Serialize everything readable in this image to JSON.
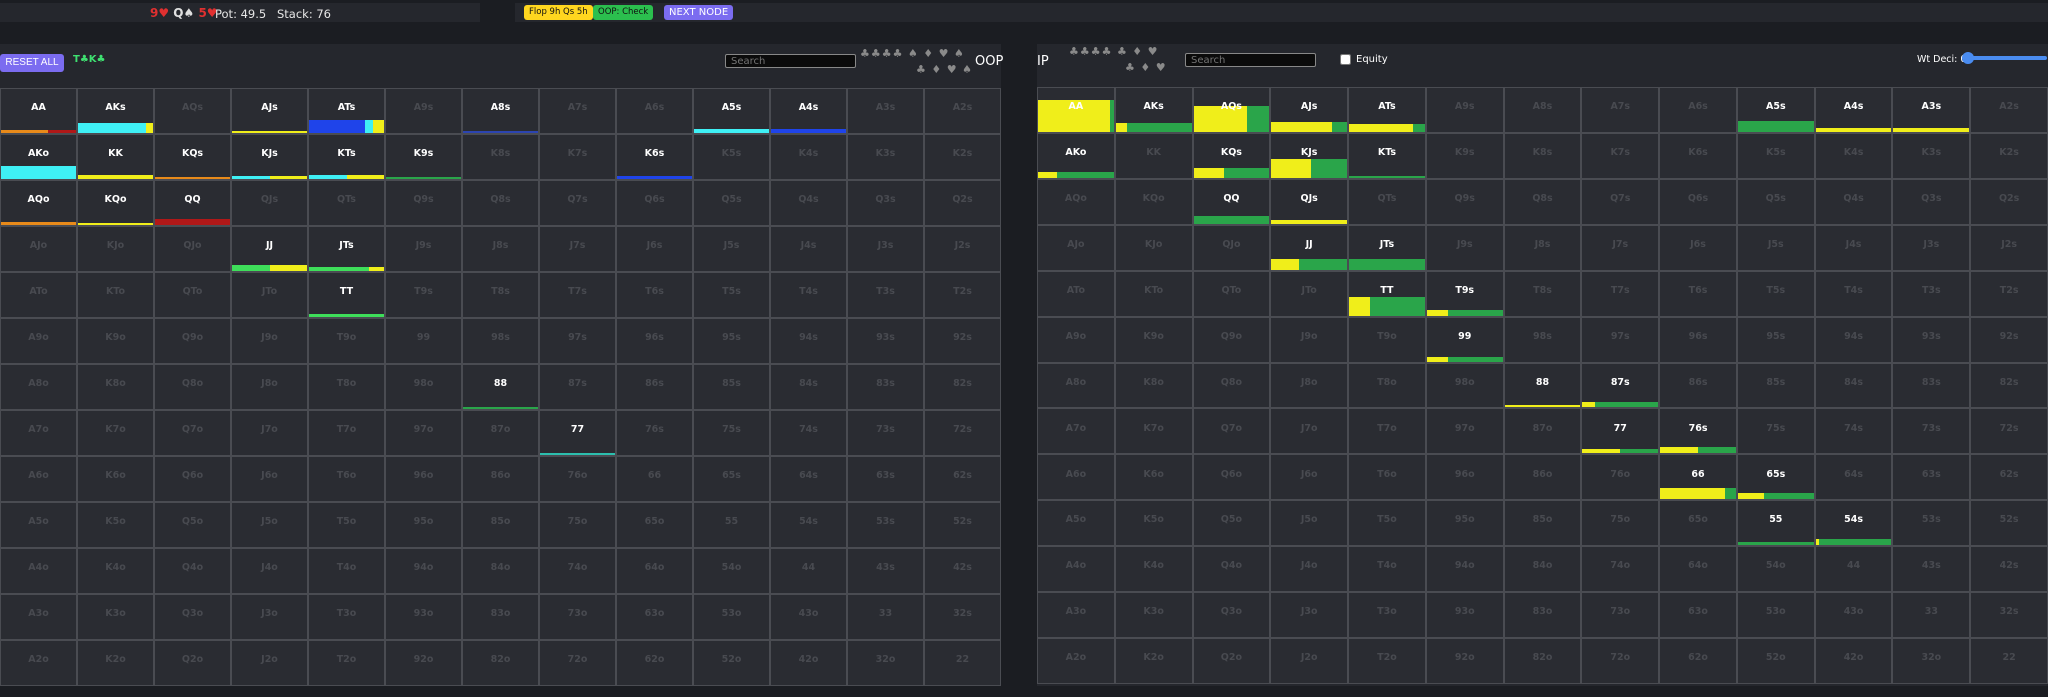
{
  "topbar": {
    "board": [
      {
        "text": "9♥",
        "color": "red"
      },
      {
        "text": "Q♠",
        "color": "black"
      },
      {
        "text": "5♥",
        "color": "red"
      }
    ],
    "pot": "Pot: 49.5",
    "stack": "Stack: 76",
    "pills": {
      "flop": "Flop 9h Qs 5h",
      "oop_action": "OOP: Check",
      "next_node": "NEXT NODE"
    }
  },
  "left_panel": {
    "reset_label": "RESET ALL",
    "turn_label": "T♣K♣",
    "search_placeholder": "Search",
    "suits_row1": "♣♣♣♣ ♠ ♦ ♥ ♠",
    "suits_row2": "♣ ♦ ♥ ♠",
    "position": "OOP"
  },
  "right_panel": {
    "position": "IP",
    "suits_row1": "♣♣♣♣ ♣ ♦ ♥",
    "suits_row2": "♣ ♦ ♥",
    "search_placeholder": "Search",
    "equity_label": "Equity",
    "wt_deci_label": "Wt Deci: 0"
  },
  "colors": {
    "cyan": "#3ff0f5",
    "yellow": "#f0ee1a",
    "green": "#2aa54a",
    "blue": "#1f44ea",
    "red": "#b01818",
    "orange": "#e88a1a",
    "teal": "#2cbfae",
    "lightgreen": "#3ede5a",
    "darkblue": "#2c44b0"
  },
  "hands": [
    [
      "AA",
      "AKs",
      "AQs",
      "AJs",
      "ATs",
      "A9s",
      "A8s",
      "A7s",
      "A6s",
      "A5s",
      "A4s",
      "A3s",
      "A2s"
    ],
    [
      "AKo",
      "KK",
      "KQs",
      "KJs",
      "KTs",
      "K9s",
      "K8s",
      "K7s",
      "K6s",
      "K5s",
      "K4s",
      "K3s",
      "K2s"
    ],
    [
      "AQo",
      "KQo",
      "QQ",
      "QJs",
      "QTs",
      "Q9s",
      "Q8s",
      "Q7s",
      "Q6s",
      "Q5s",
      "Q4s",
      "Q3s",
      "Q2s"
    ],
    [
      "AJo",
      "KJo",
      "QJo",
      "JJ",
      "JTs",
      "J9s",
      "J8s",
      "J7s",
      "J6s",
      "J5s",
      "J4s",
      "J3s",
      "J2s"
    ],
    [
      "ATo",
      "KTo",
      "QTo",
      "JTo",
      "TT",
      "T9s",
      "T8s",
      "T7s",
      "T6s",
      "T5s",
      "T4s",
      "T3s",
      "T2s"
    ],
    [
      "A9o",
      "K9o",
      "Q9o",
      "J9o",
      "T9o",
      "99",
      "98s",
      "97s",
      "96s",
      "95s",
      "94s",
      "93s",
      "92s"
    ],
    [
      "A8o",
      "K8o",
      "Q8o",
      "J8o",
      "T8o",
      "98o",
      "88",
      "87s",
      "86s",
      "85s",
      "84s",
      "83s",
      "82s"
    ],
    [
      "A7o",
      "K7o",
      "Q7o",
      "J7o",
      "T7o",
      "97o",
      "87o",
      "77",
      "76s",
      "75s",
      "74s",
      "73s",
      "72s"
    ],
    [
      "A6o",
      "K6o",
      "Q6o",
      "J6o",
      "T6o",
      "96o",
      "86o",
      "76o",
      "66",
      "65s",
      "64s",
      "63s",
      "62s"
    ],
    [
      "A5o",
      "K5o",
      "Q5o",
      "J5o",
      "T5o",
      "95o",
      "85o",
      "75o",
      "65o",
      "55",
      "54s",
      "53s",
      "52s"
    ],
    [
      "A4o",
      "K4o",
      "Q4o",
      "J4o",
      "T4o",
      "94o",
      "84o",
      "74o",
      "64o",
      "54o",
      "44",
      "43s",
      "42s"
    ],
    [
      "A3o",
      "K3o",
      "Q3o",
      "J3o",
      "T3o",
      "93o",
      "83o",
      "73o",
      "63o",
      "53o",
      "43o",
      "33",
      "32s"
    ],
    [
      "A2o",
      "K2o",
      "Q2o",
      "J2o",
      "T2o",
      "92o",
      "82o",
      "72o",
      "62o",
      "52o",
      "42o",
      "32o",
      "22"
    ]
  ],
  "oop_range": {
    "AA": {
      "h": 0.06,
      "segs": [
        [
          "orange",
          0.62
        ],
        [
          "red",
          0.38
        ]
      ]
    },
    "AKs": {
      "h": 0.22,
      "segs": [
        [
          "cyan",
          0.9
        ],
        [
          "yellow",
          0.1
        ]
      ]
    },
    "AJs": {
      "h": 0.04,
      "segs": [
        [
          "yellow",
          1
        ]
      ]
    },
    "ATs": {
      "h": 0.3,
      "segs": [
        [
          "blue",
          0.75
        ],
        [
          "cyan",
          0.1
        ],
        [
          "yellow",
          0.15
        ]
      ]
    },
    "A8s": {
      "h": 0.04,
      "segs": [
        [
          "darkblue",
          1
        ]
      ]
    },
    "A5s": {
      "h": 0.08,
      "segs": [
        [
          "cyan",
          1
        ]
      ]
    },
    "A4s": {
      "h": 0.08,
      "segs": [
        [
          "blue",
          1
        ]
      ]
    },
    "AKo": {
      "h": 0.3,
      "segs": [
        [
          "cyan",
          1
        ]
      ]
    },
    "KK": {
      "h": 0.08,
      "segs": [
        [
          "yellow",
          1
        ]
      ]
    },
    "KQs": {
      "h": 0.05,
      "segs": [
        [
          "orange",
          1
        ]
      ]
    },
    "KJs": {
      "h": 0.07,
      "segs": [
        [
          "cyan",
          0.5
        ],
        [
          "yellow",
          0.5
        ]
      ]
    },
    "KTs": {
      "h": 0.1,
      "segs": [
        [
          "cyan",
          0.5
        ],
        [
          "yellow",
          0.5
        ]
      ]
    },
    "K9s": {
      "h": 0.04,
      "segs": [
        [
          "green",
          1
        ]
      ]
    },
    "K6s": {
      "h": 0.06,
      "segs": [
        [
          "blue",
          1
        ]
      ]
    },
    "AQo": {
      "h": 0.06,
      "segs": [
        [
          "orange",
          1
        ]
      ]
    },
    "KQo": {
      "h": 0.04,
      "segs": [
        [
          "yellow",
          1
        ]
      ]
    },
    "QQ": {
      "h": 0.14,
      "segs": [
        [
          "red",
          1
        ]
      ]
    },
    "JJ": {
      "h": 0.14,
      "segs": [
        [
          "lightgreen",
          0.5
        ],
        [
          "yellow",
          0.5
        ]
      ]
    },
    "JTs": {
      "h": 0.1,
      "segs": [
        [
          "lightgreen",
          0.8
        ],
        [
          "yellow",
          0.2
        ]
      ]
    },
    "TT": {
      "h": 0.07,
      "segs": [
        [
          "lightgreen",
          1
        ]
      ]
    },
    "88": {
      "h": 0.04,
      "segs": [
        [
          "green",
          1
        ]
      ]
    },
    "77": {
      "h": 0.04,
      "segs": [
        [
          "teal",
          1
        ]
      ]
    }
  },
  "ip_range": {
    "AA": {
      "h": 0.72,
      "segs": [
        [
          "yellow",
          0.95
        ],
        [
          "green",
          0.05
        ]
      ]
    },
    "AKs": {
      "h": 0.2,
      "segs": [
        [
          "yellow",
          0.15
        ],
        [
          "green",
          0.85
        ]
      ]
    },
    "AQs": {
      "h": 0.6,
      "segs": [
        [
          "yellow",
          0.7
        ],
        [
          "green",
          0.3
        ]
      ]
    },
    "AJs": {
      "h": 0.22,
      "segs": [
        [
          "yellow",
          0.8
        ],
        [
          "green",
          0.2
        ]
      ]
    },
    "ATs": {
      "h": 0.18,
      "segs": [
        [
          "yellow",
          0.85
        ],
        [
          "green",
          0.15
        ]
      ]
    },
    "A5s": {
      "h": 0.24,
      "segs": [
        [
          "green",
          1
        ]
      ]
    },
    "A4s": {
      "h": 0.09,
      "segs": [
        [
          "yellow",
          1
        ]
      ]
    },
    "A3s": {
      "h": 0.09,
      "segs": [
        [
          "yellow",
          1
        ]
      ]
    },
    "AKo": {
      "h": 0.13,
      "segs": [
        [
          "yellow",
          0.25
        ],
        [
          "green",
          0.75
        ]
      ]
    },
    "KQs": {
      "h": 0.22,
      "segs": [
        [
          "yellow",
          0.4
        ],
        [
          "green",
          0.6
        ]
      ]
    },
    "KJs": {
      "h": 0.44,
      "segs": [
        [
          "yellow",
          0.52
        ],
        [
          "green",
          0.48
        ]
      ]
    },
    "KTs": {
      "h": 0.04,
      "segs": [
        [
          "green",
          1
        ]
      ]
    },
    "QQ": {
      "h": 0.18,
      "segs": [
        [
          "green",
          1
        ]
      ]
    },
    "QJs": {
      "h": 0.08,
      "segs": [
        [
          "yellow",
          1
        ]
      ]
    },
    "JJ": {
      "h": 0.24,
      "segs": [
        [
          "yellow",
          0.37
        ],
        [
          "green",
          0.63
        ]
      ]
    },
    "JTs": {
      "h": 0.24,
      "segs": [
        [
          "green",
          1
        ]
      ]
    },
    "TT": {
      "h": 0.42,
      "segs": [
        [
          "yellow",
          0.27
        ],
        [
          "green",
          0.73
        ]
      ]
    },
    "T9s": {
      "h": 0.12,
      "segs": [
        [
          "yellow",
          0.28
        ],
        [
          "green",
          0.72
        ]
      ]
    },
    "99": {
      "h": 0.1,
      "segs": [
        [
          "yellow",
          0.28
        ],
        [
          "green",
          0.72
        ]
      ]
    },
    "88": {
      "h": 0.05,
      "segs": [
        [
          "yellow",
          1
        ]
      ]
    },
    "87s": {
      "h": 0.13,
      "segs": [
        [
          "yellow",
          0.17
        ],
        [
          "green",
          0.83
        ]
      ]
    },
    "77": {
      "h": 0.1,
      "segs": [
        [
          "yellow",
          0.5
        ],
        [
          "green",
          0.5
        ]
      ]
    },
    "76s": {
      "h": 0.14,
      "segs": [
        [
          "yellow",
          0.5
        ],
        [
          "green",
          0.5
        ]
      ]
    },
    "66": {
      "h": 0.25,
      "segs": [
        [
          "yellow",
          0.85
        ],
        [
          "green",
          0.15
        ]
      ]
    },
    "65s": {
      "h": 0.15,
      "segs": [
        [
          "yellow",
          0.35
        ],
        [
          "green",
          0.65
        ]
      ]
    },
    "55": {
      "h": 0.07,
      "segs": [
        [
          "green",
          1
        ]
      ]
    },
    "54s": {
      "h": 0.15,
      "segs": [
        [
          "yellow",
          0.04
        ],
        [
          "green",
          0.96
        ]
      ]
    }
  }
}
